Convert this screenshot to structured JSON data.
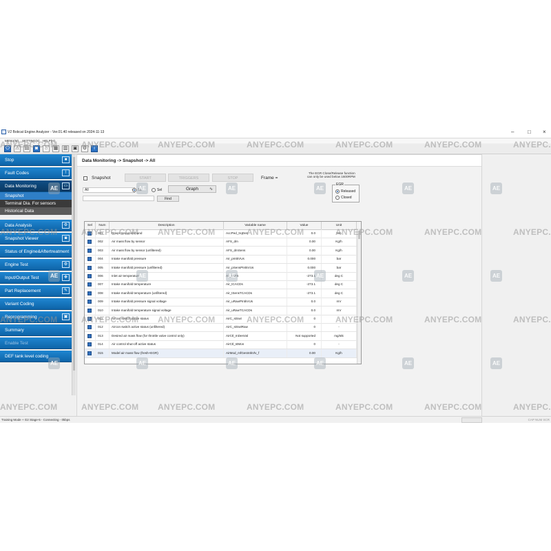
{
  "window": {
    "title": "V2 Bobcat Engine Analyzer - Ver.01.40 released on 2024-11-13"
  },
  "menu": [
    "MENU(M)",
    "SETTING(S)",
    "HELP(H)"
  ],
  "toolbar_icons": [
    "power-icon",
    "warning-icon",
    "chart-icon",
    "camera-icon",
    "home-icon",
    "grid-icon",
    "graph-icon",
    "chip-icon",
    "gear-icon",
    "info-icon"
  ],
  "sidebar": {
    "items": [
      {
        "label": "Stop",
        "icon": "stop-icon"
      },
      {
        "label": "Fault Codes",
        "icon": "warning-icon"
      },
      {
        "label": "Data Monitoring",
        "icon": "monitor-icon"
      },
      {
        "label": "Snapshot"
      },
      {
        "label": "Terminal Dia. For sensors"
      },
      {
        "label": "Historical Data"
      },
      {
        "label": "Data Analysis",
        "icon": "analysis-icon"
      },
      {
        "label": "Snapshot Viewer",
        "icon": "camera-icon"
      },
      {
        "label": "Status of Engine&Aftertreatment"
      },
      {
        "label": "Engine Test",
        "icon": "engine-icon"
      },
      {
        "label": "Input/Output Test",
        "icon": "io-icon"
      },
      {
        "label": "Part Replacement",
        "icon": "wrench-icon"
      },
      {
        "label": "Variant Coding"
      },
      {
        "label": "Reprogramming",
        "icon": "chip-icon"
      },
      {
        "label": "Summary"
      },
      {
        "label": "Enable Test"
      },
      {
        "label": "DEF tank level coding"
      }
    ]
  },
  "main": {
    "breadcrumb": "Data Monitoring -> Snapshot -> All",
    "snapshot_label": "Snapshot",
    "buttons": {
      "start": "START",
      "triggers": "TRIGGERS",
      "stop": "STOP",
      "find": "Find",
      "graph": "Graph"
    },
    "frame_label": "Frame =",
    "egr_note_line1": "The EGR Close/Release function",
    "egr_note_line2": "can only be used below 1600RPM",
    "filter": {
      "select_value": "All",
      "radio_all": "All",
      "radio_sel": "Sel",
      "search_value": ""
    },
    "egr": {
      "title": "EGR",
      "opt_released": "Released",
      "opt_closed": "Closed",
      "selected": "Released"
    }
  },
  "table": {
    "headers": [
      "Sel",
      "Num",
      "Description",
      "Variable name",
      "Value",
      "Unit"
    ],
    "rows": [
      {
        "num": "001",
        "desc": "Driver torque demand",
        "var": "AccPed_trqDes",
        "value": "0.0",
        "unit": "Nm"
      },
      {
        "num": "002",
        "desc": "Air mass flow by sensor",
        "var": "AFS_dm",
        "value": "0.00",
        "unit": "Kg/h"
      },
      {
        "num": "003",
        "desc": "Air mass flow by sensor (unfiltered)",
        "var": "AFS_dmSens",
        "value": "0.00",
        "unit": "Kg/h"
      },
      {
        "num": "004",
        "desc": "Intake manifold pressure",
        "var": "Air_pIntkVUs",
        "value": "0.000",
        "unit": "bar"
      },
      {
        "num": "005",
        "desc": "Intake manifold pressure (unfiltered)",
        "var": "Air_pSensPIntkVUs",
        "value": "0.000",
        "unit": "bar"
      },
      {
        "num": "006",
        "desc": "Inlet air temperature",
        "var": "Air_tAFS",
        "value": "-273.1",
        "unit": "deg C"
      },
      {
        "num": "007",
        "desc": "Intake manifold temperature",
        "var": "Air_tCACDs",
        "value": "-273.1",
        "unit": "deg C"
      },
      {
        "num": "008",
        "desc": "Intake manifold temperature (unfiltered)",
        "var": "Air_tSensTCACDs",
        "value": "-273.1",
        "unit": "deg C"
      },
      {
        "num": "009",
        "desc": "Intake manifold pressure signal voltage",
        "var": "Air_uRawPIntkVUs",
        "value": "0.0",
        "unit": "mV"
      },
      {
        "num": "010",
        "desc": "Intake manifold temperature signal voltage",
        "var": "Air_uRawTCACDs",
        "value": "0.0",
        "unit": "mV"
      },
      {
        "num": "011",
        "desc": "Aircon switch active status",
        "var": "AirC_stSwt",
        "value": "0",
        "unit": "-"
      },
      {
        "num": "012",
        "desc": "Aircon switch active status (unfiltered)",
        "var": "AirC_stSwtRaw",
        "value": "0",
        "unit": "-"
      },
      {
        "num": "013",
        "desc": "Desired air mass flow (for throttle valve control only)",
        "var": "AirCtl_mDesVal",
        "value": "Not supported",
        "unit": "mg/stk"
      },
      {
        "num": "014",
        "desc": "Air control shut-off active status",
        "var": "AirCtl_stMon",
        "value": "0",
        "unit": "-"
      },
      {
        "num": "015",
        "desc": "Model air mass flow (fresh+EGR)",
        "var": "AirMod_mfGesIntkVlv_f",
        "value": "0.00",
        "unit": "Kg/h"
      }
    ]
  },
  "status": {
    "left": "Training Mode + G2 Stage-5 - Connecting - 0kbps",
    "right": "CAP  NUM  SCR"
  },
  "watermark": {
    "text": "ANYEPC.COM",
    "logo": "AE"
  }
}
